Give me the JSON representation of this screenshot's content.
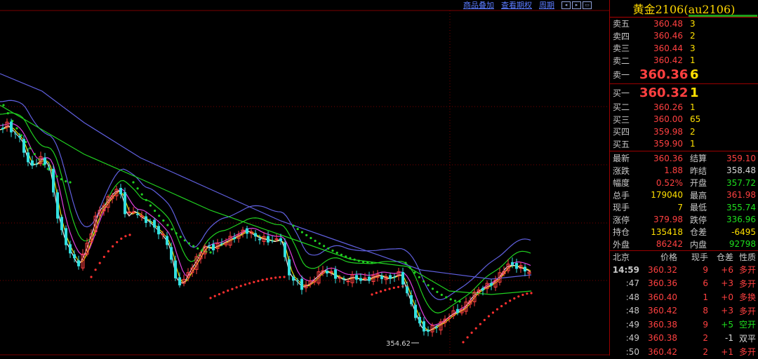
{
  "toolbar": {
    "items": [
      "商品叠加",
      "查看期权",
      "周期"
    ]
  },
  "instrument": {
    "title": "黄金2106(au2106)"
  },
  "orderbook": {
    "asks": [
      {
        "label": "卖五",
        "price": "360.48",
        "volume": "3"
      },
      {
        "label": "卖四",
        "price": "360.46",
        "volume": "2"
      },
      {
        "label": "卖三",
        "price": "360.44",
        "volume": "3"
      },
      {
        "label": "卖二",
        "price": "360.42",
        "volume": "1"
      },
      {
        "label": "卖一",
        "price": "360.36",
        "volume": "6"
      }
    ],
    "bids": [
      {
        "label": "买一",
        "price": "360.32",
        "volume": "1"
      },
      {
        "label": "买二",
        "price": "360.26",
        "volume": "1"
      },
      {
        "label": "买三",
        "price": "360.00",
        "volume": "65"
      },
      {
        "label": "买四",
        "price": "359.98",
        "volume": "2"
      },
      {
        "label": "买五",
        "price": "359.90",
        "volume": "1"
      }
    ]
  },
  "stats": [
    {
      "l1": "最新",
      "v1": "360.36",
      "c1": "red",
      "l2": "结算",
      "v2": "359.10",
      "c2": "red"
    },
    {
      "l1": "涨跌",
      "v1": "1.88",
      "c1": "red",
      "l2": "昨结",
      "v2": "358.48",
      "c2": "white"
    },
    {
      "l1": "幅度",
      "v1": "0.52%",
      "c1": "red",
      "l2": "开盘",
      "v2": "357.72",
      "c2": "green"
    },
    {
      "l1": "总手",
      "v1": "179040",
      "c1": "yellow",
      "l2": "最高",
      "v2": "361.98",
      "c2": "red"
    },
    {
      "l1": "现手",
      "v1": "7",
      "c1": "yellow",
      "l2": "最低",
      "v2": "355.74",
      "c2": "green"
    },
    {
      "l1": "涨停",
      "v1": "379.98",
      "c1": "red",
      "l2": "跌停",
      "v2": "336.96",
      "c2": "green"
    },
    {
      "l1": "持仓",
      "v1": "135418",
      "c1": "yellow",
      "l2": "仓差",
      "v2": "-6495",
      "c2": "yellow"
    },
    {
      "l1": "外盘",
      "v1": "86242",
      "c1": "red",
      "l2": "内盘",
      "v2": "92798",
      "c2": "green"
    }
  ],
  "trades_header": {
    "loc": "北京",
    "price": "价格",
    "qty": "现手",
    "diff": "仓差",
    "nature": "性质"
  },
  "trades": [
    {
      "time": "14:59",
      "price": "360.32",
      "qty": "9",
      "diff": "+6",
      "nature": "多开",
      "pc": "red",
      "nc": "red"
    },
    {
      "time": ":47",
      "price": "360.36",
      "qty": "6",
      "diff": "+3",
      "nature": "多开",
      "pc": "red",
      "nc": "red"
    },
    {
      "time": ":48",
      "price": "360.40",
      "qty": "1",
      "diff": "+0",
      "nature": "多换",
      "pc": "red",
      "nc": "red"
    },
    {
      "time": ":48",
      "price": "360.42",
      "qty": "8",
      "diff": "+3",
      "nature": "多开",
      "pc": "red",
      "nc": "red"
    },
    {
      "time": ":49",
      "price": "360.38",
      "qty": "9",
      "diff": "+5",
      "nature": "空开",
      "pc": "red",
      "nc": "green"
    },
    {
      "time": ":49",
      "price": "360.38",
      "qty": "2",
      "diff": "-1",
      "nature": "双平",
      "pc": "red",
      "nc": "white"
    },
    {
      "time": ":50",
      "price": "360.42",
      "qty": "2",
      "diff": "+1",
      "nature": "多开",
      "pc": "red",
      "nc": "red"
    }
  ],
  "chart_data": {
    "type": "candlestick",
    "annotation_low": "354.62",
    "colors": {
      "up": "#ff4040",
      "down": "#33e0e0",
      "ma1": "#e8e8e8",
      "ma2": "#e8e000",
      "ma3": "#e040e0",
      "ma4": "#20d020",
      "ma5": "#6060e0",
      "sar_up": "#ff3030",
      "sar_down": "#20d020"
    }
  }
}
